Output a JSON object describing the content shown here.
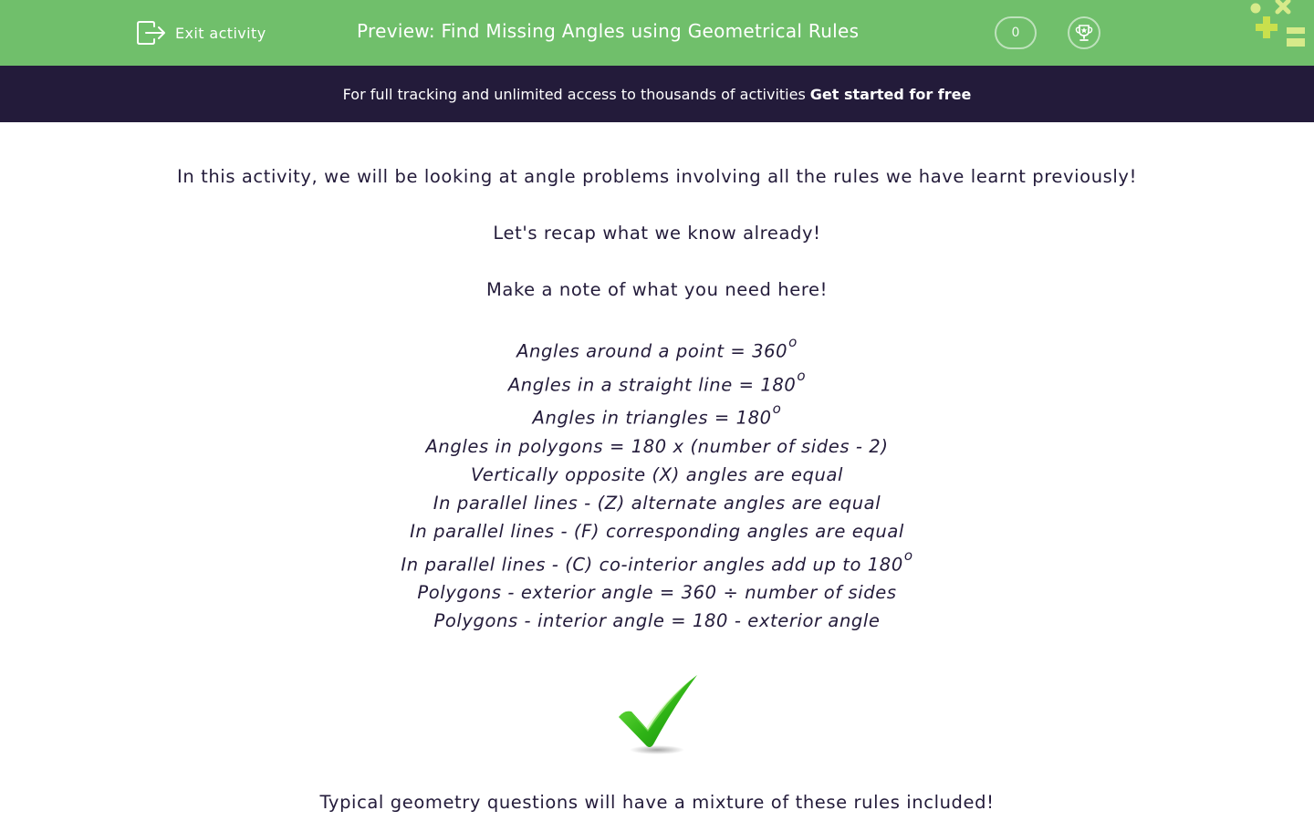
{
  "topbar": {
    "exit_label": "Exit activity",
    "title": "Preview: Find Missing Angles using Geometrical Rules",
    "score": "0",
    "bg_color": "#70bf6b"
  },
  "promo": {
    "text": "For full tracking and unlimited access to thousands of activities",
    "cta": "Get started for free",
    "bg_color": "#231b3a"
  },
  "content": {
    "intro": "In this activity, we will be looking at angle problems involving all the rules we have learnt previously!",
    "recap": "Let's recap what we know already!",
    "note": "Make a note of what you need here!",
    "rules": [
      {
        "text": "Angles around a point = 360",
        "sup": "o"
      },
      {
        "text": "Angles in a straight line = 180",
        "sup": "o"
      },
      {
        "text": "Angles in triangles = 180",
        "sup": "o"
      },
      {
        "text": "Angles in polygons = 180 x (number of sides - 2)",
        "sup": ""
      },
      {
        "text": "Vertically opposite (X) angles are equal",
        "sup": ""
      },
      {
        "text": "In parallel lines - (Z) alternate angles are equal",
        "sup": ""
      },
      {
        "text": "In parallel lines - (F) corresponding angles are equal",
        "sup": ""
      },
      {
        "text": "In parallel lines - (C) co-interior angles add up to 180",
        "sup": "o"
      },
      {
        "text": "Polygons - exterior angle = 360 ÷ number of sides",
        "sup": ""
      },
      {
        "text": "Polygons - interior angle = 180 - exterior angle",
        "sup": ""
      }
    ],
    "outro": "Typical geometry questions will have a mixture of these rules included!"
  },
  "icons": {
    "exit": "exit-icon",
    "trophy": "trophy-icon",
    "brand": "brand-logo",
    "tick": "checkmark-icon"
  }
}
